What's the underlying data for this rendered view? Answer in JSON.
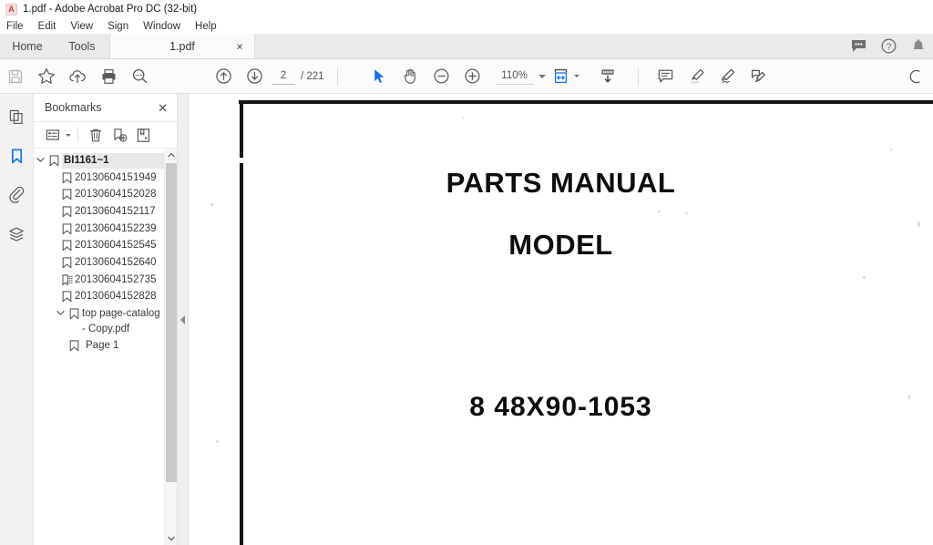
{
  "window": {
    "title": "1.pdf - Adobe Acrobat Pro DC (32-bit)",
    "logo_letter": "A"
  },
  "menubar": {
    "items": [
      {
        "label": "File"
      },
      {
        "label": "Edit"
      },
      {
        "label": "View"
      },
      {
        "label": "Sign"
      },
      {
        "label": "Window"
      },
      {
        "label": "Help"
      }
    ]
  },
  "tabs": {
    "home_label": "Home",
    "tools_label": "Tools",
    "document_label": "1.pdf",
    "close_glyph": "×",
    "right_icons": [
      {
        "name": "feedback-icon"
      },
      {
        "name": "help-icon",
        "glyph": "?"
      },
      {
        "name": "notification-bell-icon"
      }
    ]
  },
  "toolbar": {
    "save_label": "Save file",
    "star_label": "Add to favorites",
    "upload_label": "Upload to cloud",
    "print_label": "Print file",
    "search_label": "Find text",
    "prev_page_label": "Previous page",
    "next_page_label": "Next page",
    "page_number": "2",
    "page_total": "/ 221",
    "select_tool_label": "Select tool",
    "hand_tool_label": "Hand tool",
    "zoom_out_label": "Zoom out",
    "zoom_in_label": "Zoom in",
    "zoom_level": "110%",
    "fit_label": "Fit page width",
    "scroll_mode_label": "Scroll mode",
    "comment_label": "Add comment",
    "highlight_label": "Highlight text",
    "draw_label": "Draw free form",
    "sign_label": "Fill and sign"
  },
  "navrail": {
    "items": [
      {
        "name": "page-thumbnails",
        "label": "Page Thumbnails",
        "active": false
      },
      {
        "name": "bookmarks",
        "label": "Bookmarks",
        "active": true
      },
      {
        "name": "attachments",
        "label": "Attachments",
        "active": false
      },
      {
        "name": "layers",
        "label": "Layers",
        "active": false
      }
    ]
  },
  "bookmarks_panel": {
    "title": "Bookmarks",
    "close_glyph": "✕",
    "toolbar": {
      "options_label": "Bookmark options",
      "delete_label": "Delete bookmark",
      "new_label": "New bookmark",
      "edit_label": "Edit bookmark"
    },
    "tree": [
      {
        "label": "BI1161~1",
        "level": 0,
        "expanded": true,
        "icon": "bookmark-icon",
        "selected": true
      },
      {
        "label": "20130604151949",
        "level": 1,
        "icon": "bookmark-icon"
      },
      {
        "label": "20130604152028",
        "level": 1,
        "icon": "bookmark-icon"
      },
      {
        "label": "20130604152117",
        "level": 1,
        "icon": "bookmark-icon"
      },
      {
        "label": "20130604152239",
        "level": 1,
        "icon": "bookmark-icon"
      },
      {
        "label": "20130604152545",
        "level": 1,
        "icon": "bookmark-icon"
      },
      {
        "label": "20130604152640",
        "level": 1,
        "icon": "bookmark-icon"
      },
      {
        "label": "20130604152735",
        "level": 1,
        "icon": "bookmark-structure-icon"
      },
      {
        "label": "20130604152828",
        "level": 1,
        "icon": "bookmark-icon"
      },
      {
        "label": "top page-catalog - Copy.pdf",
        "level": 1,
        "expanded": true,
        "icon": "bookmark-icon"
      },
      {
        "label": "Page 1",
        "level": 2,
        "icon": "bookmark-icon"
      }
    ]
  },
  "document": {
    "title_line1": "PARTS MANUAL",
    "title_line2": "MODEL",
    "model_number": "8 48X90-1053"
  },
  "colors": {
    "accent_blue": "#1473e6",
    "toolbar_bg": "#fbfbfb",
    "tabbar_bg": "#eaeaea",
    "panel_bg": "#ffffff",
    "icon_grey": "#5a5a5a",
    "disabled_grey": "#b6b6b6"
  }
}
